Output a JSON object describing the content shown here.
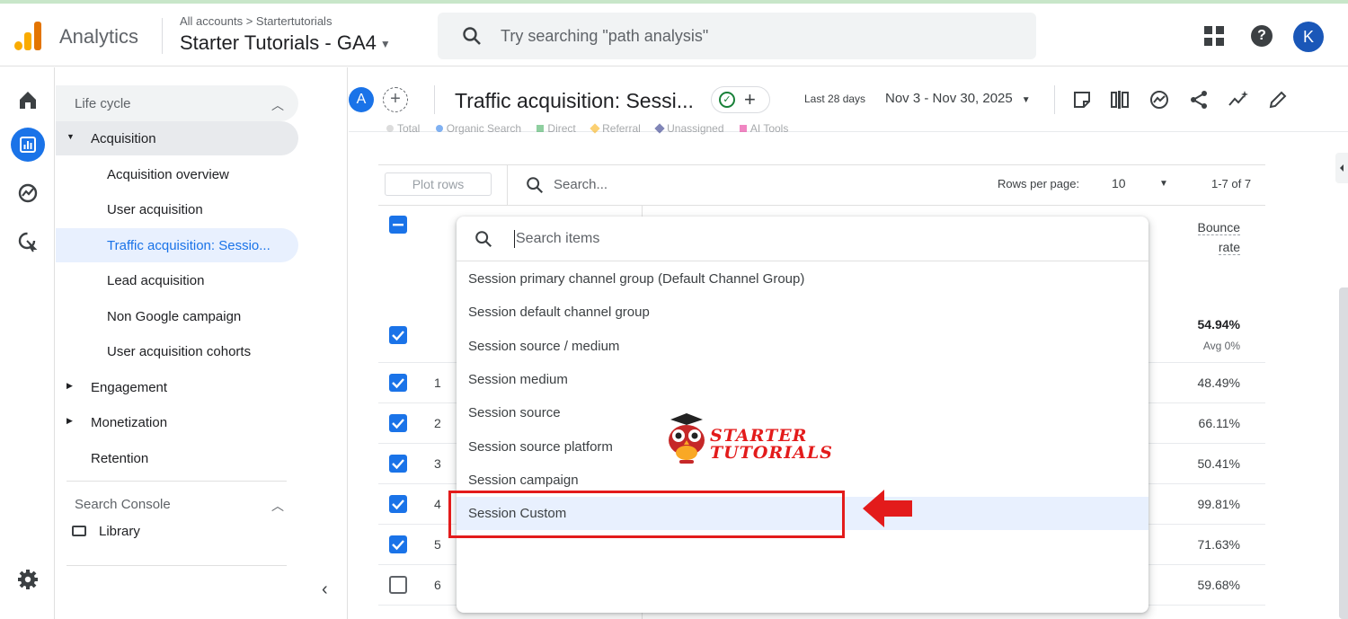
{
  "header": {
    "app_name": "Analytics",
    "breadcrumb": "All accounts > Startertutorials",
    "property": "Starter Tutorials - GA4",
    "search_placeholder": "Try searching \"path analysis\"",
    "avatar_letter": "K"
  },
  "rail": {
    "icons": [
      "home-icon",
      "reports-icon",
      "explore-icon",
      "advertising-icon",
      "settings-icon"
    ]
  },
  "nav": {
    "section": "Life cycle",
    "acquisition": "Acquisition",
    "acq_items": [
      "Acquisition overview",
      "User acquisition",
      "Traffic acquisition: Sessio...",
      "Lead acquisition",
      "Non Google campaign",
      "User acquisition cohorts"
    ],
    "engagement": "Engagement",
    "monetization": "Monetization",
    "retention": "Retention",
    "search_console": "Search Console",
    "library": "Library"
  },
  "report": {
    "compare_letter": "A",
    "title": "Traffic acquisition: Sessi...",
    "date_label": "Last 28 days",
    "date_range": "Nov 3 - Nov 30, 2025",
    "legend": [
      "Total",
      "Organic Search",
      "Direct",
      "Referral",
      "Unassigned",
      "AI Tools"
    ],
    "legend_colors": [
      "#c0c0c0",
      "#1a73e8",
      "#34a853",
      "#f9ab00",
      "#1a237e",
      "#e52592"
    ]
  },
  "table": {
    "plot_rows": "Plot rows",
    "search_placeholder": "Search...",
    "rows_per_page_label": "Rows per page:",
    "rows_per_page": "10",
    "pager": "1-7 of 7",
    "col_bounce_line1": "Bounce",
    "col_bounce_line2": "rate",
    "total_value": "54.94%",
    "total_avg": "Avg 0%",
    "rows": [
      {
        "num": "1",
        "value": "48.49%",
        "checked": true
      },
      {
        "num": "2",
        "value": "66.11%",
        "checked": true
      },
      {
        "num": "3",
        "value": "50.41%",
        "checked": true
      },
      {
        "num": "4",
        "value": "99.81%",
        "checked": true
      },
      {
        "num": "5",
        "value": "71.63%",
        "checked": true
      },
      {
        "num": "6",
        "value": "59.68%",
        "checked": false
      }
    ]
  },
  "dropdown": {
    "search_placeholder": "Search items",
    "items": [
      "Session primary channel group (Default Channel Group)",
      "Session default channel group",
      "Session source / medium",
      "Session medium",
      "Session source",
      "Session source platform",
      "Session campaign",
      "Session Custom"
    ],
    "highlighted_index": 7
  },
  "watermark": {
    "line1": "STARTER",
    "line2": "TUTORIALS"
  },
  "colors": {
    "accent": "#1a73e8",
    "highlight_box": "#e31b1b"
  }
}
